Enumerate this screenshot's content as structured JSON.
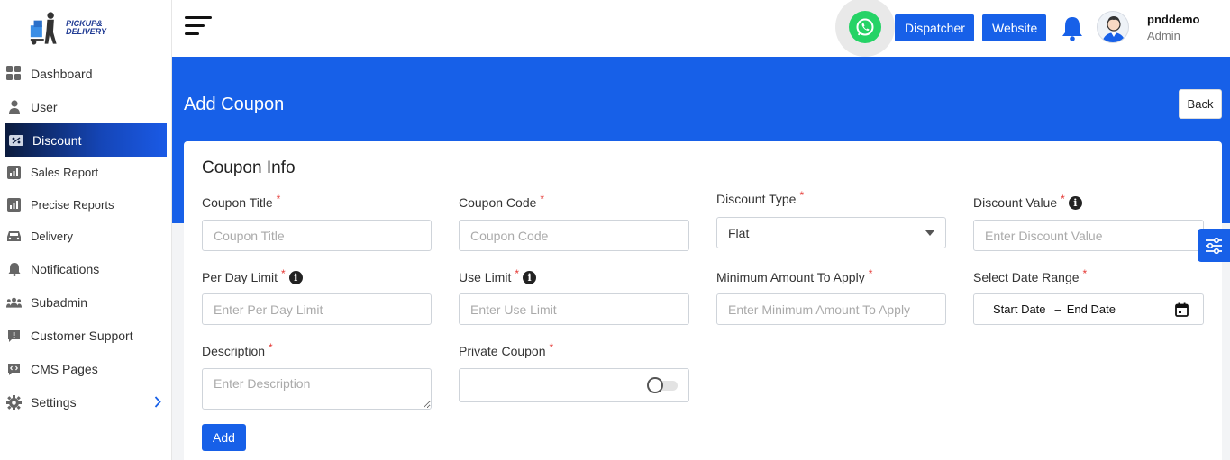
{
  "brand": {
    "logo_line1": "PICKUP&",
    "logo_line2": "DELIVERY"
  },
  "sidebar": {
    "items": [
      {
        "label": "Dashboard",
        "icon": "grid-icon"
      },
      {
        "label": "User",
        "icon": "user-icon"
      },
      {
        "label": "Discount",
        "icon": "discount-icon",
        "active": true
      },
      {
        "label": "Sales Report",
        "icon": "chart-icon"
      },
      {
        "label": "Precise Reports",
        "icon": "chart-icon"
      },
      {
        "label": "Delivery",
        "icon": "car-icon"
      },
      {
        "label": "Notifications",
        "icon": "bell-icon"
      },
      {
        "label": "Subadmin",
        "icon": "users-icon"
      },
      {
        "label": "Customer Support",
        "icon": "chat-icon"
      },
      {
        "label": "CMS Pages",
        "icon": "code-chat-icon"
      },
      {
        "label": "Settings",
        "icon": "gear-icon"
      }
    ]
  },
  "header": {
    "dispatcher_label": "Dispatcher",
    "website_label": "Website",
    "user_name": "pnddemo",
    "user_role": "Admin"
  },
  "page": {
    "title": "Add Coupon",
    "back_label": "Back"
  },
  "form": {
    "section_title": "Coupon Info",
    "coupon_title": {
      "label": "Coupon Title",
      "placeholder": "Coupon Title"
    },
    "coupon_code": {
      "label": "Coupon Code",
      "placeholder": "Coupon Code"
    },
    "discount_type": {
      "label": "Discount Type",
      "value": "Flat"
    },
    "discount_value": {
      "label": "Discount Value",
      "placeholder": "Enter Discount Value"
    },
    "per_day_limit": {
      "label": "Per Day Limit",
      "placeholder": "Enter Per Day Limit"
    },
    "use_limit": {
      "label": "Use Limit",
      "placeholder": "Enter Use Limit"
    },
    "min_amount": {
      "label": "Minimum Amount To Apply",
      "placeholder": "Enter Minimum Amount To Apply"
    },
    "date_range": {
      "label": "Select Date Range",
      "start": "Start Date",
      "separator": "–",
      "end": "End Date"
    },
    "description": {
      "label": "Description",
      "placeholder": "Enter Description"
    },
    "private_coupon": {
      "label": "Private Coupon",
      "enabled": false
    },
    "required_mark": "*",
    "info_mark": "i",
    "add_label": "Add"
  },
  "colors": {
    "primary": "#1760e8",
    "required": "#e53935",
    "whatsapp": "#25d366"
  }
}
